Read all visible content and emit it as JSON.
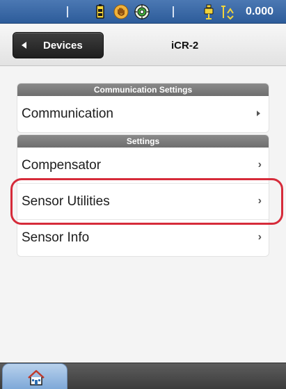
{
  "statusbar": {
    "icons": [
      "battery-icon",
      "stop-hand-icon",
      "target-icon",
      "prism-icon",
      "signal-bars-icon"
    ],
    "value": "0.000",
    "colors": {
      "bar": "#2d5c9a",
      "text": "#ffffff"
    }
  },
  "header": {
    "back_label": "Devices",
    "title": "iCR-2"
  },
  "groups": [
    {
      "header": "Communication Settings",
      "items": [
        {
          "label": "Communication",
          "chevron": "triangle"
        }
      ]
    },
    {
      "header": "Settings",
      "items": [
        {
          "label": "Compensator",
          "chevron": "angle"
        },
        {
          "label": "Sensor Utilities",
          "chevron": "angle",
          "highlighted": true
        },
        {
          "label": "Sensor Info",
          "chevron": "angle"
        }
      ]
    }
  ],
  "footer": {
    "home_icon": "home-icon",
    "tab_color": "#9cbde2",
    "highlight_color": "#d62b3a"
  }
}
